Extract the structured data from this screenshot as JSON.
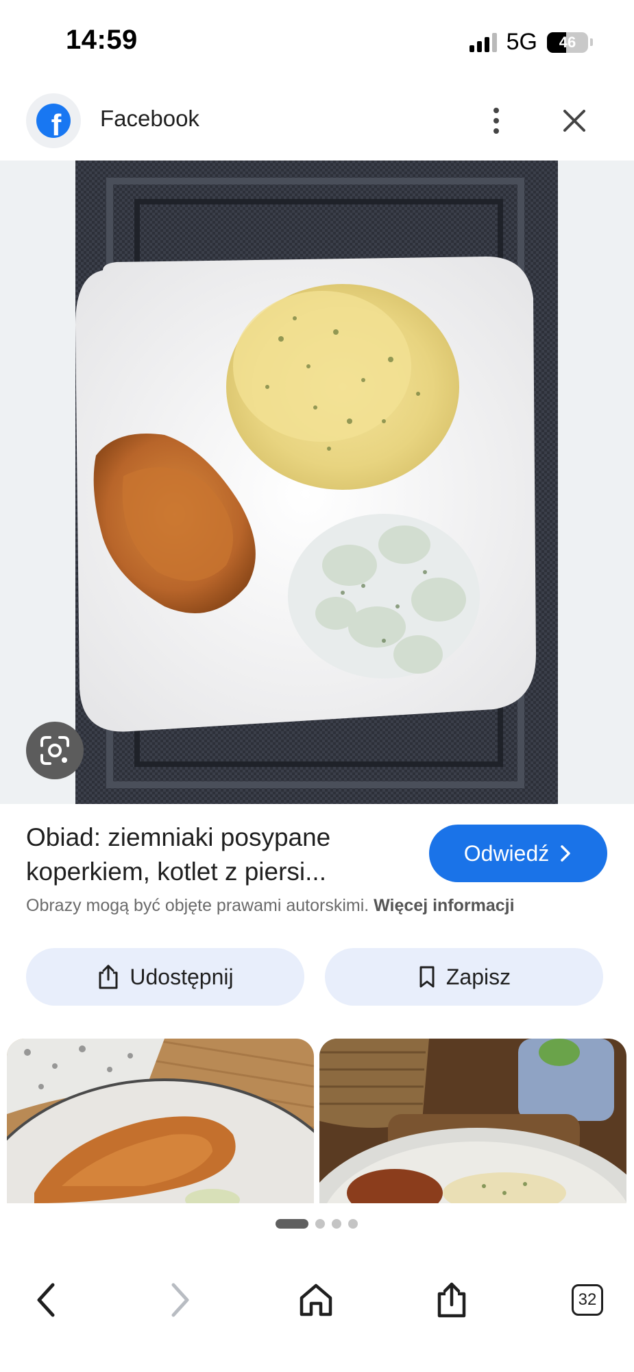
{
  "status_bar": {
    "time": "14:59",
    "network": "5G",
    "battery": "46",
    "battery_level": 0.46
  },
  "header": {
    "logo_icon": "facebook-logo",
    "site_name": "Facebook"
  },
  "image_viewer": {
    "photo": "plate with mashed potatoes with dill, breaded chicken cutlets and cucumber salad",
    "lens_icon": "google-lens-icon"
  },
  "result": {
    "title": "Obiad: ziemniaki posypane koperkiem, kotlet z piersi...",
    "visit_label": "Odwiedź",
    "copyright_text": "Obrazy mogą być objęte prawami autorskimi.",
    "more_info_label": "Więcej informacji"
  },
  "actions": {
    "share_label": "Udostępnij",
    "save_label": "Zapisz"
  },
  "pager": {
    "count": 4,
    "active": 0
  },
  "toolbar": {
    "tabs_count": "32"
  },
  "colors": {
    "accent": "#1a73e8",
    "facebook_blue": "#1877f2",
    "action_button_bg": "#e8eefb"
  }
}
